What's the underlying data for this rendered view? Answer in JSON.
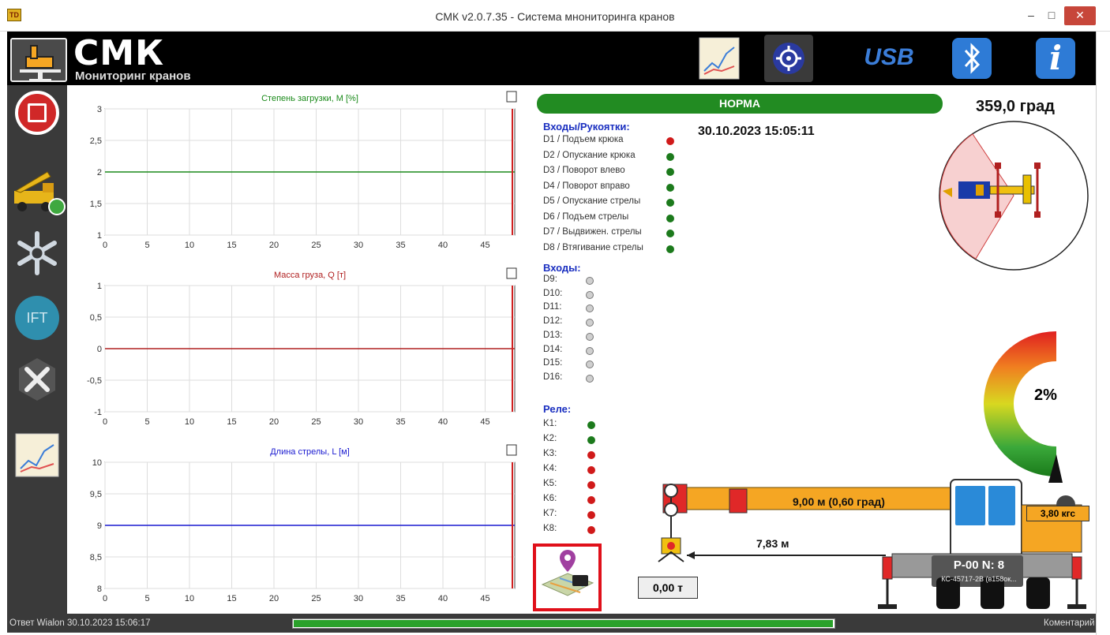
{
  "window": {
    "title": "СМК v2.0.7.35 - Система мнониторинга кранов",
    "app_icon_text": "TD",
    "minimize": "–",
    "maximize": "□",
    "close": "✕"
  },
  "header": {
    "logo_title": "СМК",
    "logo_subtitle": "Мониторинг кранов",
    "buttons": [
      "chart-icon",
      "target-icon",
      "usb-icon",
      "bluetooth-icon",
      "info-icon"
    ],
    "usb_label": "USB",
    "info_label": "i"
  },
  "sidebar": {
    "items": [
      "stop-icon",
      "crane-truck-icon",
      "snowflake-icon",
      "ift-icon",
      "tools-icon",
      "chart-icon"
    ],
    "ift_label": "IFT"
  },
  "charts": [
    {
      "title": "Степень загрузки, M [%]",
      "color": "#1a8a1a",
      "y_ticks": [
        "3",
        "2,5",
        "2",
        "1,5",
        "1"
      ],
      "x_ticks": [
        "0",
        "5",
        "10",
        "15",
        "20",
        "25",
        "30",
        "35",
        "40",
        "45"
      ]
    },
    {
      "title": "Масса груза, Q [т]",
      "color": "#b02020",
      "y_ticks": [
        "1",
        "0,5",
        "0",
        "-0,5",
        "-1"
      ],
      "x_ticks": [
        "0",
        "5",
        "10",
        "15",
        "20",
        "25",
        "30",
        "35",
        "40",
        "45"
      ]
    },
    {
      "title": "Длина стрелы, L [м]",
      "color": "#1a1ad0",
      "y_ticks": [
        "10",
        "9,5",
        "9",
        "8,5",
        "8"
      ],
      "x_ticks": [
        "0",
        "5",
        "10",
        "15",
        "20",
        "25",
        "30",
        "35",
        "40",
        "45"
      ]
    }
  ],
  "chart_data": [
    {
      "type": "line",
      "title": "Степень загрузки, M [%]",
      "xlim": [
        0,
        48.5
      ],
      "ylim": [
        1,
        3
      ],
      "series": [
        {
          "x": [
            0,
            48.5
          ],
          "values": [
            2,
            2
          ]
        }
      ],
      "grid": true
    },
    {
      "type": "line",
      "title": "Масса груза, Q [т]",
      "xlim": [
        0,
        48.5
      ],
      "ylim": [
        -1,
        1
      ],
      "series": [
        {
          "x": [
            0,
            48.5
          ],
          "values": [
            0,
            0
          ]
        }
      ],
      "grid": true
    },
    {
      "type": "line",
      "title": "Длина стрелы, L [м]",
      "xlim": [
        0,
        48.5
      ],
      "ylim": [
        8,
        10
      ],
      "series": [
        {
          "x": [
            0,
            48.5
          ],
          "values": [
            9,
            9
          ]
        }
      ],
      "grid": true
    }
  ],
  "status": {
    "norma": "НОРМА",
    "datetime": "30.10.2023 15:05:11",
    "angle": "359,0 град",
    "load_percent": "2%",
    "load_value": 0.02
  },
  "inputs_handles": {
    "title": "Входы/Рукоятки:",
    "items": [
      {
        "label": "D1 / Подъем крюка",
        "state": "red"
      },
      {
        "label": "D2 / Опускание крюка",
        "state": "green"
      },
      {
        "label": "D3 / Поворот влево",
        "state": "green"
      },
      {
        "label": "D4 / Поворот вправо",
        "state": "green"
      },
      {
        "label": "D5 / Опускание стрелы",
        "state": "green"
      },
      {
        "label": "D6 / Подъем стрелы",
        "state": "green"
      },
      {
        "label": "D7 / Выдвижен. стрелы",
        "state": "green"
      },
      {
        "label": "D8 / Втягивание стрелы",
        "state": "green"
      }
    ]
  },
  "inputs": {
    "title": "Входы:",
    "items": [
      {
        "label": "D9:",
        "state": "grey"
      },
      {
        "label": "D10:",
        "state": "grey"
      },
      {
        "label": "D11:",
        "state": "grey"
      },
      {
        "label": "D12:",
        "state": "grey"
      },
      {
        "label": "D13:",
        "state": "grey"
      },
      {
        "label": "D14:",
        "state": "grey"
      },
      {
        "label": "D15:",
        "state": "grey"
      },
      {
        "label": "D16:",
        "state": "grey"
      }
    ]
  },
  "relays": {
    "title": "Реле:",
    "items": [
      {
        "label": "K1:",
        "state": "green"
      },
      {
        "label": "K2:",
        "state": "green"
      },
      {
        "label": "K3:",
        "state": "red"
      },
      {
        "label": "K4:",
        "state": "red"
      },
      {
        "label": "K5:",
        "state": "red"
      },
      {
        "label": "K6:",
        "state": "red"
      },
      {
        "label": "K7:",
        "state": "red"
      },
      {
        "label": "K8:",
        "state": "red"
      }
    ]
  },
  "crane": {
    "boom_label": "9,00 м (0,60 град)",
    "radius_label": "7,83 м",
    "load_label": "0,00 т",
    "force_label": "3,80 кгс",
    "plate_title": "Р-00  N: 8",
    "plate_sub": "КС-45717-2В (в158ок..."
  },
  "statusbar": {
    "left": "Ответ Wialon 30.10.2023 15:06:17",
    "right": "Коментарий",
    "progress": 0.995
  },
  "colors": {
    "norma": "#228b22",
    "dot_green": "#1c7a1c",
    "dot_red": "#d01a1a",
    "boom": "#f5a623",
    "highlight": "#e0101a"
  }
}
